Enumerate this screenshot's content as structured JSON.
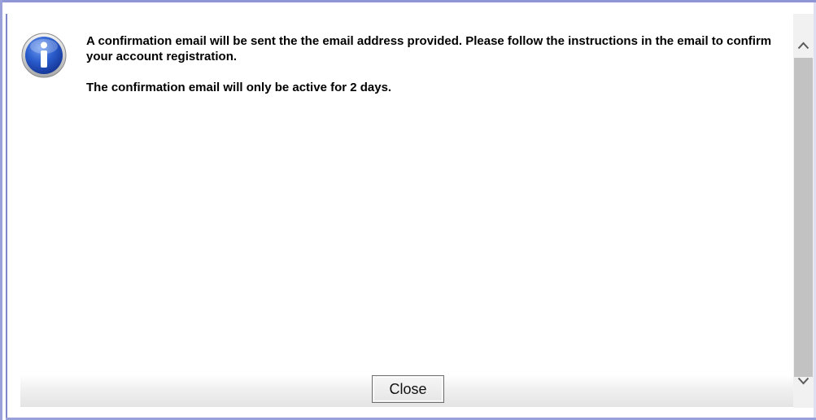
{
  "dialog": {
    "icon": "info-icon",
    "message": {
      "paragraph_1": "A confirmation email will be sent the the email address provided. Please follow the instructions in the email to confirm your account registration.",
      "paragraph_2": "The confirmation email will only be active for 2 days."
    },
    "close_label": "Close"
  },
  "scrollbar": {
    "up_icon": "chevron-up-icon",
    "down_icon": "chevron-down-icon"
  },
  "colors": {
    "frame_border": "#8e96d6",
    "icon_blue": "#1f4fb8",
    "scroll_thumb": "#c2c2c2"
  }
}
